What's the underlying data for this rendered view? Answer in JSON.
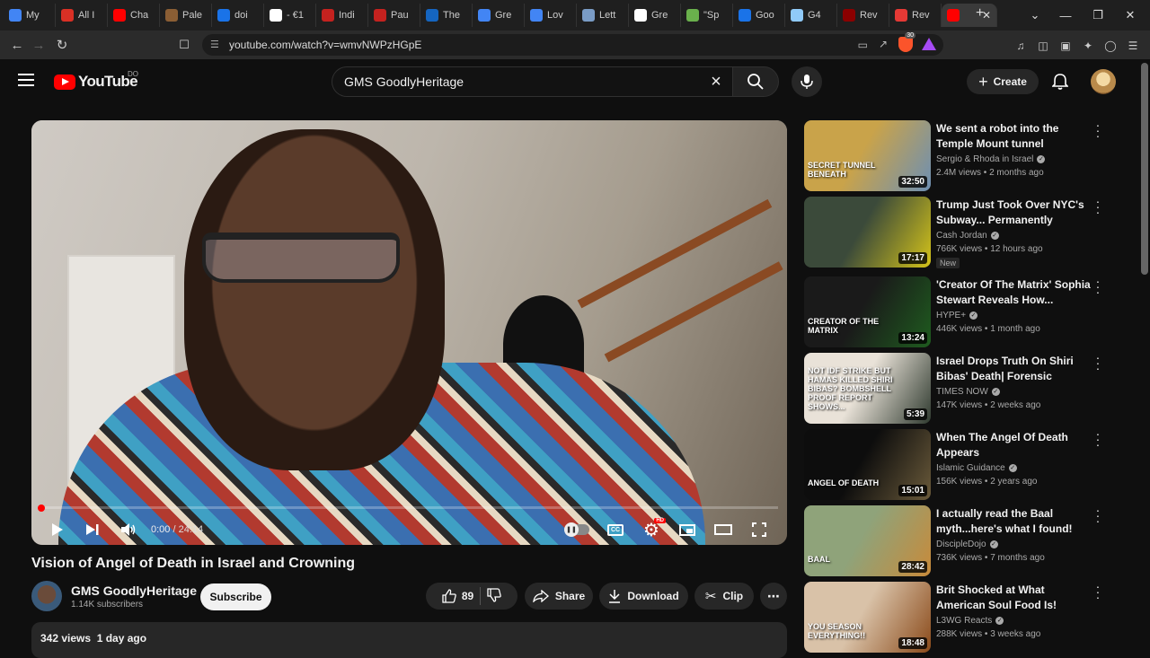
{
  "browser": {
    "tabs": [
      {
        "label": "My",
        "color": "#4285f4"
      },
      {
        "label": "All I",
        "color": "#d93025"
      },
      {
        "label": "Cha",
        "color": "#ff0000"
      },
      {
        "label": "Pale",
        "color": "#8b5e34"
      },
      {
        "label": "doi",
        "color": "#1a73e8"
      },
      {
        "label": "- €1",
        "color": "#ffffff"
      },
      {
        "label": "Indi",
        "color": "#c5221f"
      },
      {
        "label": "Pau",
        "color": "#c5221f"
      },
      {
        "label": "The",
        "color": "#1565c0"
      },
      {
        "label": "Gre",
        "color": "#4285f4"
      },
      {
        "label": "Lov",
        "color": "#4285f4"
      },
      {
        "label": "Lett",
        "color": "#7a9cc6"
      },
      {
        "label": "Gre",
        "color": "#ffffff"
      },
      {
        "label": "\"Sp",
        "color": "#6ab04c"
      },
      {
        "label": "Goo",
        "color": "#1a73e8"
      },
      {
        "label": "G4",
        "color": "#90caf9"
      },
      {
        "label": "Rev",
        "color": "#8b0000"
      },
      {
        "label": "Rev",
        "color": "#e53935"
      },
      {
        "label": "",
        "color": "#ff0000",
        "active": true
      }
    ],
    "url": "youtube.com/watch?v=wmvNWPzHGpE",
    "brave_badge": "30"
  },
  "youtube": {
    "logo_text": "YouTube",
    "logo_country": "DO",
    "search_value": "GMS GoodlyHeritage",
    "create_label": "Create"
  },
  "player": {
    "current_time": "0:00",
    "duration": "/ 24:14",
    "progress": 0
  },
  "video": {
    "title": "Vision of Angel of Death in Israel and Crowning",
    "channel": "GMS GoodlyHeritage",
    "subscribers": "1.14K subscribers",
    "subscribe_label": "Subscribe",
    "likes": "89",
    "share_label": "Share",
    "download_label": "Download",
    "clip_label": "Clip",
    "views_date": "342 views  1 day ago"
  },
  "recommendations": [
    {
      "title": "We sent a robot into the Temple Mount tunnel",
      "channel": "Sergio & Rhoda in Israel",
      "meta": "2.4M views • 2 months ago",
      "duration": "32:50",
      "badge": "",
      "thumb_a": "#c9a34a",
      "thumb_b": "#6d8fb3",
      "thumb_text": "SECRET TUNNEL BENEATH"
    },
    {
      "title": "Trump Just Took Over NYC's Subway... Permanently",
      "channel": "Cash Jordan",
      "meta": "766K views • 12 hours ago",
      "duration": "17:17",
      "badge": "New",
      "thumb_a": "#3b4a3a",
      "thumb_b": "#d4c31a",
      "thumb_text": ""
    },
    {
      "title": "'Creator Of The Matrix' Sophia Stewart Reveals How...",
      "channel": "HYPE+",
      "meta": "446K views • 1 month ago",
      "duration": "13:24",
      "badge": "",
      "thumb_a": "#1a1a1a",
      "thumb_b": "#1f5c1f",
      "thumb_text": "CREATOR OF THE MATRIX"
    },
    {
      "title": "Israel Drops Truth On Shiri Bibas' Death| Forensic Report...",
      "channel": "TIMES NOW",
      "meta": "147K views • 2 weeks ago",
      "duration": "5:39",
      "badge": "",
      "thumb_a": "#e9e2d8",
      "thumb_b": "#2f3a2f",
      "thumb_text": "NOT IDF STRIKE BUT HAMAS KILLED SHIRI BIBAS? BOMBSHELL PROOF REPORT SHOWS..."
    },
    {
      "title": "When The Angel Of Death Appears",
      "channel": "Islamic Guidance",
      "meta": "156K views • 2 years ago",
      "duration": "15:01",
      "badge": "",
      "thumb_a": "#0d0d0d",
      "thumb_b": "#6a5a3a",
      "thumb_text": "ANGEL OF DEATH"
    },
    {
      "title": "I actually read the Baal myth...here's what I found! (Pa...",
      "channel": "DiscipleDojo",
      "meta": "736K views • 7 months ago",
      "duration": "28:42",
      "badge": "",
      "thumb_a": "#8fa37a",
      "thumb_b": "#c88a3a",
      "thumb_text": "BAAL"
    },
    {
      "title": "Brit Shocked at What American Soul Food Is!",
      "channel": "L3WG Reacts",
      "meta": "288K views • 3 weeks ago",
      "duration": "18:48",
      "badge": "",
      "thumb_a": "#d9c2a8",
      "thumb_b": "#8a4a1a",
      "thumb_text": "YOU SEASON EVERYTHING!!"
    }
  ]
}
